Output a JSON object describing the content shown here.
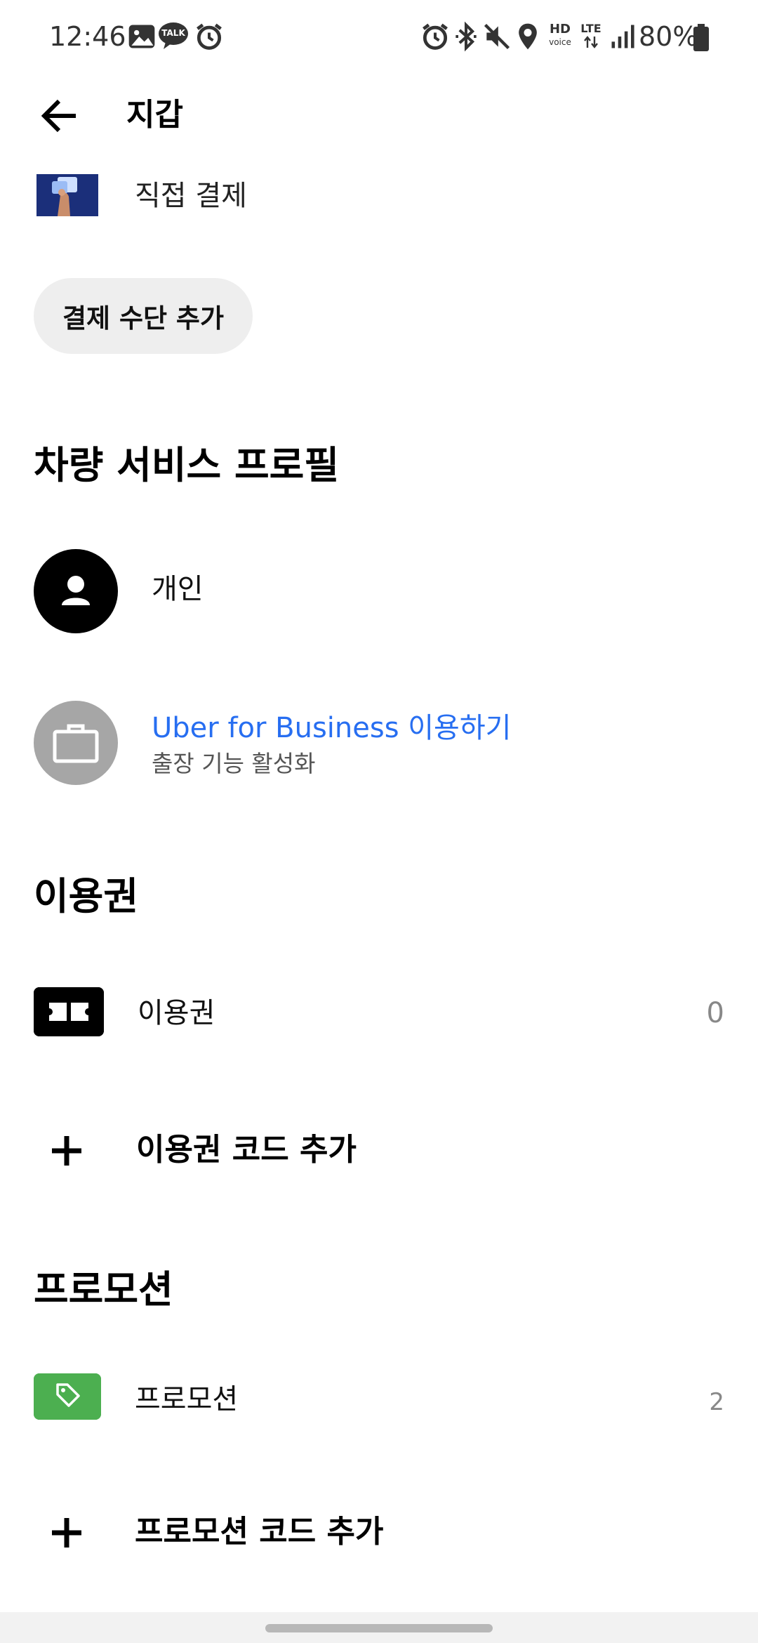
{
  "status_bar": {
    "time": "12:46",
    "left_icons": [
      "image-icon",
      "talk-icon",
      "alarm-icon"
    ],
    "right_icons": [
      "alarm-icon",
      "bluetooth-icon",
      "mute-icon",
      "location-icon",
      "hd-voice-icon",
      "lte-icon",
      "signal-icon"
    ],
    "hd_label": "HD",
    "voice_label": "voice",
    "lte_label": "LTE",
    "talk_label": "TALK",
    "battery": "80%"
  },
  "header": {
    "title": "지갑",
    "back_icon": "arrow-left-icon"
  },
  "payment": {
    "method_label": "직접 결제",
    "add_button": "결제 수단 추가"
  },
  "vehicle_profiles": {
    "title": "차량 서비스 프로필",
    "personal_label": "개인",
    "business_label": "Uber for Business 이용하기",
    "business_sub": "출장 기능 활성화",
    "business_color": "#276ef1"
  },
  "vouchers": {
    "title": "이용권",
    "item_label": "이용권",
    "item_count": "0",
    "add_label": "이용권 코드 추가"
  },
  "promotions": {
    "title": "프로모션",
    "item_label": "프로모션",
    "item_count": "2",
    "add_label": "프로모션 코드 추가",
    "accent_color": "#4caf50"
  }
}
